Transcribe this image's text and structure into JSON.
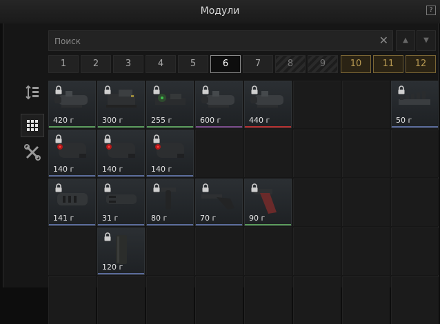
{
  "window": {
    "title": "Модули",
    "help": "?"
  },
  "search": {
    "placeholder": "Поиск",
    "clear": "✕"
  },
  "nav": {
    "up": "▲",
    "down": "▼"
  },
  "pages": [
    {
      "label": "1",
      "state": "normal"
    },
    {
      "label": "2",
      "state": "normal"
    },
    {
      "label": "3",
      "state": "normal"
    },
    {
      "label": "4",
      "state": "normal"
    },
    {
      "label": "5",
      "state": "normal"
    },
    {
      "label": "6",
      "state": "active"
    },
    {
      "label": "7",
      "state": "normal"
    },
    {
      "label": "8",
      "state": "locked"
    },
    {
      "label": "9",
      "state": "locked"
    },
    {
      "label": "10",
      "state": "gold"
    },
    {
      "label": "11",
      "state": "gold"
    },
    {
      "label": "12",
      "state": "gold"
    }
  ],
  "sidebar": [
    {
      "name": "sort-icon",
      "selected": false
    },
    {
      "name": "grid-view-icon",
      "selected": true
    },
    {
      "name": "tools-icon",
      "selected": false
    }
  ],
  "items": [
    {
      "id": "scope-1",
      "weight": "420 г",
      "locked": true,
      "accent": "#5a9a5a",
      "icon": "rifle-scope-icon"
    },
    {
      "id": "holosight",
      "weight": "300 г",
      "locked": true,
      "accent": "#5a9a5a",
      "icon": "holographic-sight-icon"
    },
    {
      "id": "reflex-sight",
      "weight": "255 г",
      "locked": true,
      "accent": "#5a9a5a",
      "icon": "reflex-sight-icon"
    },
    {
      "id": "scope-2",
      "weight": "600 г",
      "locked": true,
      "accent": "#7a4a8a",
      "icon": "rifle-scope-icon"
    },
    {
      "id": "scope-3",
      "weight": "440 г",
      "locked": true,
      "accent": "#b83030",
      "icon": "rifle-scope-icon"
    },
    {
      "id": "rail",
      "weight": "50 г",
      "locked": true,
      "accent": "#5a6a9a",
      "icon": "rail-mount-icon"
    },
    {
      "id": "laser-1",
      "weight": "140 г",
      "locked": true,
      "accent": "#5a6a9a",
      "icon": "laser-module-icon"
    },
    {
      "id": "laser-2",
      "weight": "140 г",
      "locked": true,
      "accent": "#5a6a9a",
      "icon": "laser-module-icon"
    },
    {
      "id": "laser-3",
      "weight": "140 г",
      "locked": true,
      "accent": "#5a6a9a",
      "icon": "laser-module-icon"
    },
    {
      "id": "muzzle-1",
      "weight": "141 г",
      "locked": true,
      "accent": "#5a6a9a",
      "icon": "muzzle-brake-icon"
    },
    {
      "id": "muzzle-2",
      "weight": "31 г",
      "locked": true,
      "accent": "#5a6a9a",
      "icon": "flash-hider-icon"
    },
    {
      "id": "grip-1",
      "weight": "80 г",
      "locked": true,
      "accent": "#5a6a9a",
      "icon": "foregrip-icon"
    },
    {
      "id": "grip-2",
      "weight": "70 г",
      "locked": true,
      "accent": "#5a6a9a",
      "icon": "angled-grip-icon"
    },
    {
      "id": "grip-3",
      "weight": "90 г",
      "locked": true,
      "accent": "#5a9a5a",
      "icon": "pistol-grip-icon"
    },
    {
      "id": "magazine",
      "weight": "120 г",
      "locked": true,
      "accent": "#5a6a9a",
      "icon": "magazine-icon"
    }
  ]
}
